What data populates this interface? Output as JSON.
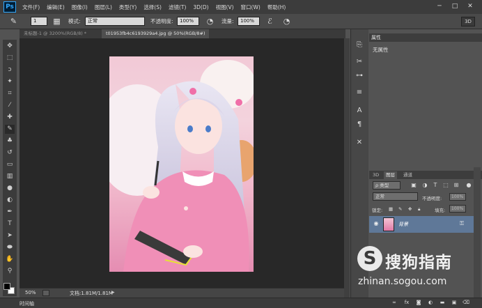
{
  "app": {
    "logo": "Ps"
  },
  "menu": [
    "文件(F)",
    "编辑(E)",
    "图像(I)",
    "图层(L)",
    "类型(Y)",
    "选择(S)",
    "滤镜(T)",
    "3D(D)",
    "视图(V)",
    "窗口(W)",
    "帮助(H)"
  ],
  "window_controls": [
    "─",
    "□",
    "✕"
  ],
  "options": {
    "mode_label": "模式:",
    "mode_value": "正常",
    "opacity_label": "不透明度:",
    "opacity_value": "100%",
    "flow_label": "流量:",
    "flow_value": "100%",
    "brush_size": "1",
    "btn_3d": "3D"
  },
  "tabs": [
    {
      "label": "未标题-1 @ 3200%(RGB/8) *",
      "active": false
    },
    {
      "label": "t01953fb4c6193929a4.jpg @ 50%(RGB/8#)",
      "active": true
    }
  ],
  "status": {
    "zoom": "50%",
    "doc": "文档:1.81M/1.81M"
  },
  "timeline": "时间轴",
  "properties": {
    "tab": "属性",
    "body": "无属性"
  },
  "layers": {
    "tabs": [
      "3D",
      "图层",
      "通道"
    ],
    "filter_kind": "ρ 类型",
    "blend_mode": "正常",
    "opacity_label": "不透明度:",
    "opacity_value": "100%",
    "lock_label": "锁定:",
    "fill_label": "填充:",
    "fill_value": "100%",
    "layer_name": "背景"
  },
  "watermark": {
    "logo": "S",
    "text": "搜狗指南",
    "url": "zhinan.sogou.com"
  },
  "colors": {
    "foreground": "#000000",
    "background": "#ffffff",
    "selected_layer": "#5f7898"
  }
}
